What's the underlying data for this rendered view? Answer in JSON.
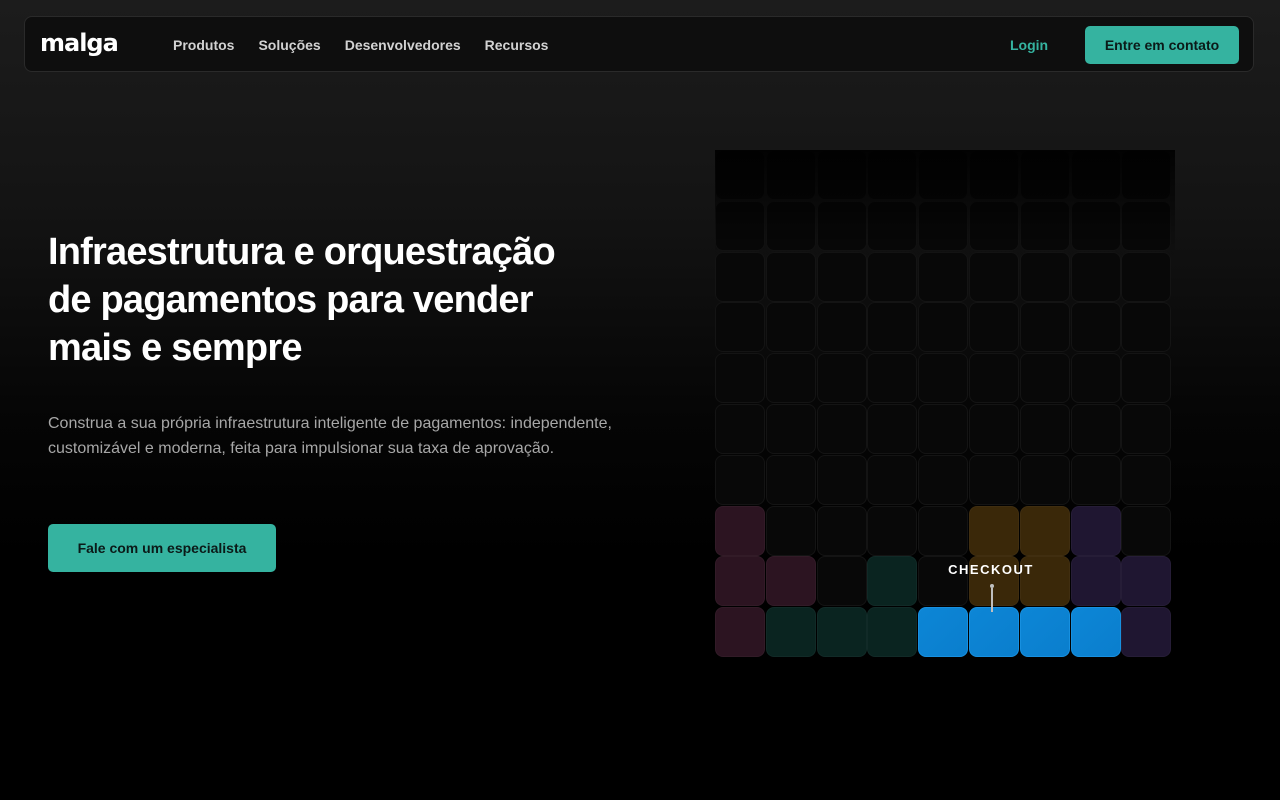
{
  "brand": {
    "logo": "malga",
    "accent_color": "#35b3a0"
  },
  "nav": {
    "items": [
      "Produtos",
      "Soluções",
      "Desenvolvedores",
      "Recursos"
    ],
    "login_label": "Login",
    "contact_label": "Entre em contato"
  },
  "hero": {
    "title_lines": [
      "Infraestrutura e orquestração",
      "de pagamentos para vender",
      "mais e sempre"
    ],
    "subtitle": "Construa a sua própria infraestrutura inteligente de pagamentos: independente, customizável e moderna, feita para impulsionar sua taxa de aprovação.",
    "cta_label": "Fale com um especialista"
  },
  "illustration": {
    "checkout_label": "CHECKOUT",
    "colors": {
      "empty": "#080808",
      "maroon": "#2c1421",
      "green": "#0a2420",
      "brown": "#3a2809",
      "purple": "#1f1631",
      "blue": "#0a7ecd"
    },
    "rows": [
      [
        "maroon",
        "empty",
        "empty",
        "empty",
        "empty",
        "brown",
        "brown",
        "purple",
        "empty"
      ],
      [
        "maroon",
        "maroon",
        "empty",
        "green",
        "empty",
        "brown",
        "brown",
        "purple",
        "purple"
      ],
      [
        "maroon",
        "green",
        "green",
        "green",
        "blue",
        "blue",
        "blue",
        "blue",
        "purple"
      ]
    ]
  }
}
